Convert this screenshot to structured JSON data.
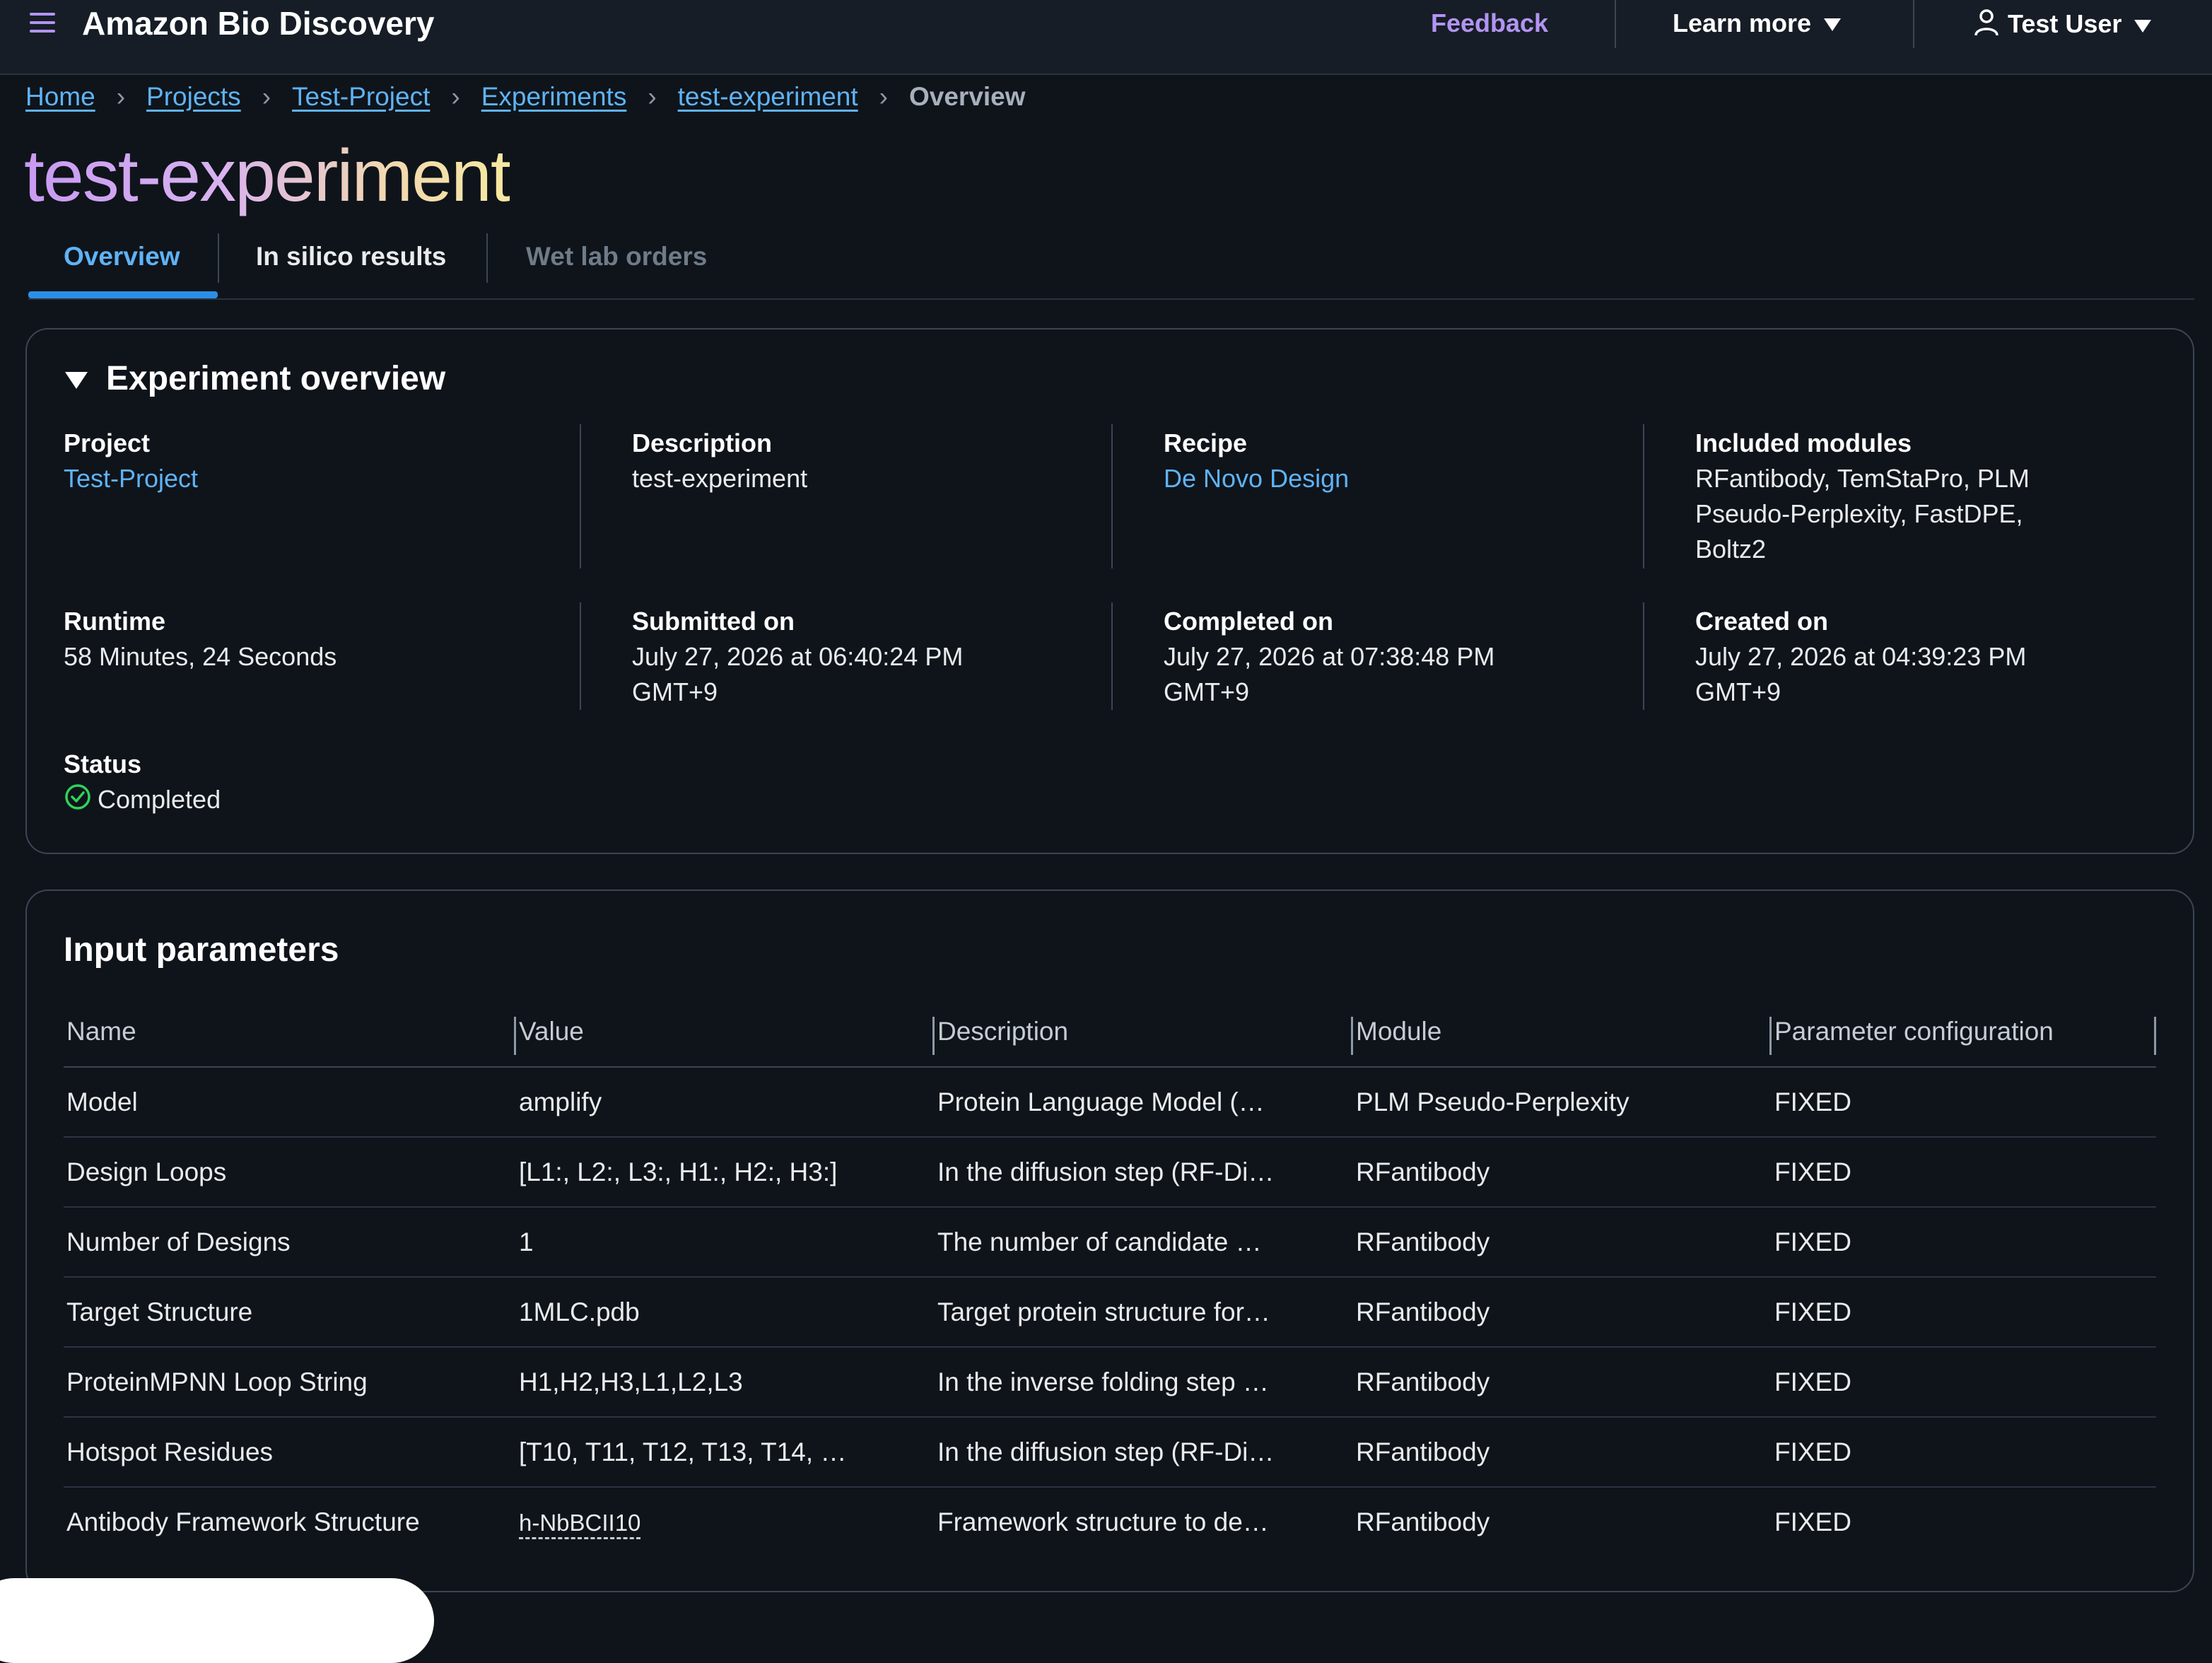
{
  "header": {
    "app_title": "Amazon Bio Discovery",
    "feedback": "Feedback",
    "learn_more": "Learn more",
    "user": "Test User"
  },
  "breadcrumb": [
    "Home",
    "Projects",
    "Test-Project",
    "Experiments",
    "test-experiment",
    "Overview"
  ],
  "page_title": "test-experiment",
  "tabs": [
    "Overview",
    "In silico results",
    "Wet lab orders"
  ],
  "overview": {
    "heading": "Experiment overview",
    "project_label": "Project",
    "project_value": "Test-Project",
    "description_label": "Description",
    "description_value": "test-experiment",
    "recipe_label": "Recipe",
    "recipe_value": "De Novo Design",
    "modules_label": "Included modules",
    "modules_line1": "RFantibody, TemStaPro, PLM",
    "modules_line2": "Pseudo-Perplexity, FastDPE,",
    "modules_line3": "Boltz2",
    "runtime_label": "Runtime",
    "runtime_value": "58 Minutes, 24 Seconds",
    "submitted_label": "Submitted on",
    "submitted_line1": "July 27, 2026 at 06:40:24 PM",
    "submitted_line2": "GMT+9",
    "completed_label": "Completed on",
    "completed_line1": "July 27, 2026 at 07:38:48 PM",
    "completed_line2": "GMT+9",
    "created_label": "Created on",
    "created_line1": "July 27, 2026 at 04:39:23 PM",
    "created_line2": "GMT+9",
    "status_label": "Status",
    "status_value": "Completed",
    "status_color": "#2fd35a"
  },
  "params": {
    "title": "Input parameters",
    "columns": [
      "Name",
      "Value",
      "Description",
      "Module",
      "Parameter configuration"
    ],
    "rows": [
      [
        "Model",
        "amplify",
        "Protein Language Model (…",
        "PLM Pseudo-Perplexity",
        "FIXED"
      ],
      [
        "Design Loops",
        "[L1:, L2:, L3:, H1:, H2:, H3:]",
        "In the diffusion step (RF-Di…",
        "RFantibody",
        "FIXED"
      ],
      [
        "Number of Designs",
        "1",
        "The number of candidate …",
        "RFantibody",
        "FIXED"
      ],
      [
        "Target Structure",
        "1MLC.pdb",
        "Target protein structure for…",
        "RFantibody",
        "FIXED"
      ],
      [
        "ProteinMPNN Loop String",
        "H1,H2,H3,L1,L2,L3",
        "In the inverse folding step …",
        "RFantibody",
        "FIXED"
      ],
      [
        "Hotspot Residues",
        "[T10, T11, T12, T13, T14, …",
        "In the diffusion step (RF-Di…",
        "RFantibody",
        "FIXED"
      ],
      [
        "Antibody Framework Structure",
        "h-NbBCII10",
        "Framework structure to de…",
        "RFantibody",
        "FIXED"
      ]
    ]
  }
}
